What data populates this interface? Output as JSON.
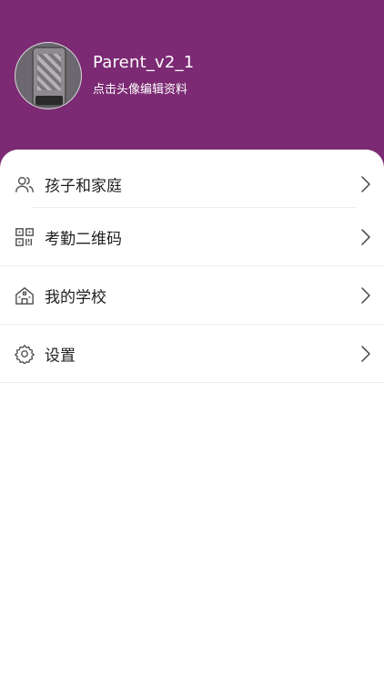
{
  "profile": {
    "name": "Parent_v2_1",
    "edit_hint": "点击头像编辑资料"
  },
  "menu": {
    "items": [
      {
        "label": "孩子和家庭",
        "icon": "users-icon"
      },
      {
        "label": "考勤二维码",
        "icon": "qr-code-icon"
      },
      {
        "label": "我的学校",
        "icon": "school-icon"
      },
      {
        "label": "设置",
        "icon": "gear-icon"
      }
    ]
  },
  "colors": {
    "header_background": "#7b2a73",
    "icon_gray": "#555555"
  }
}
